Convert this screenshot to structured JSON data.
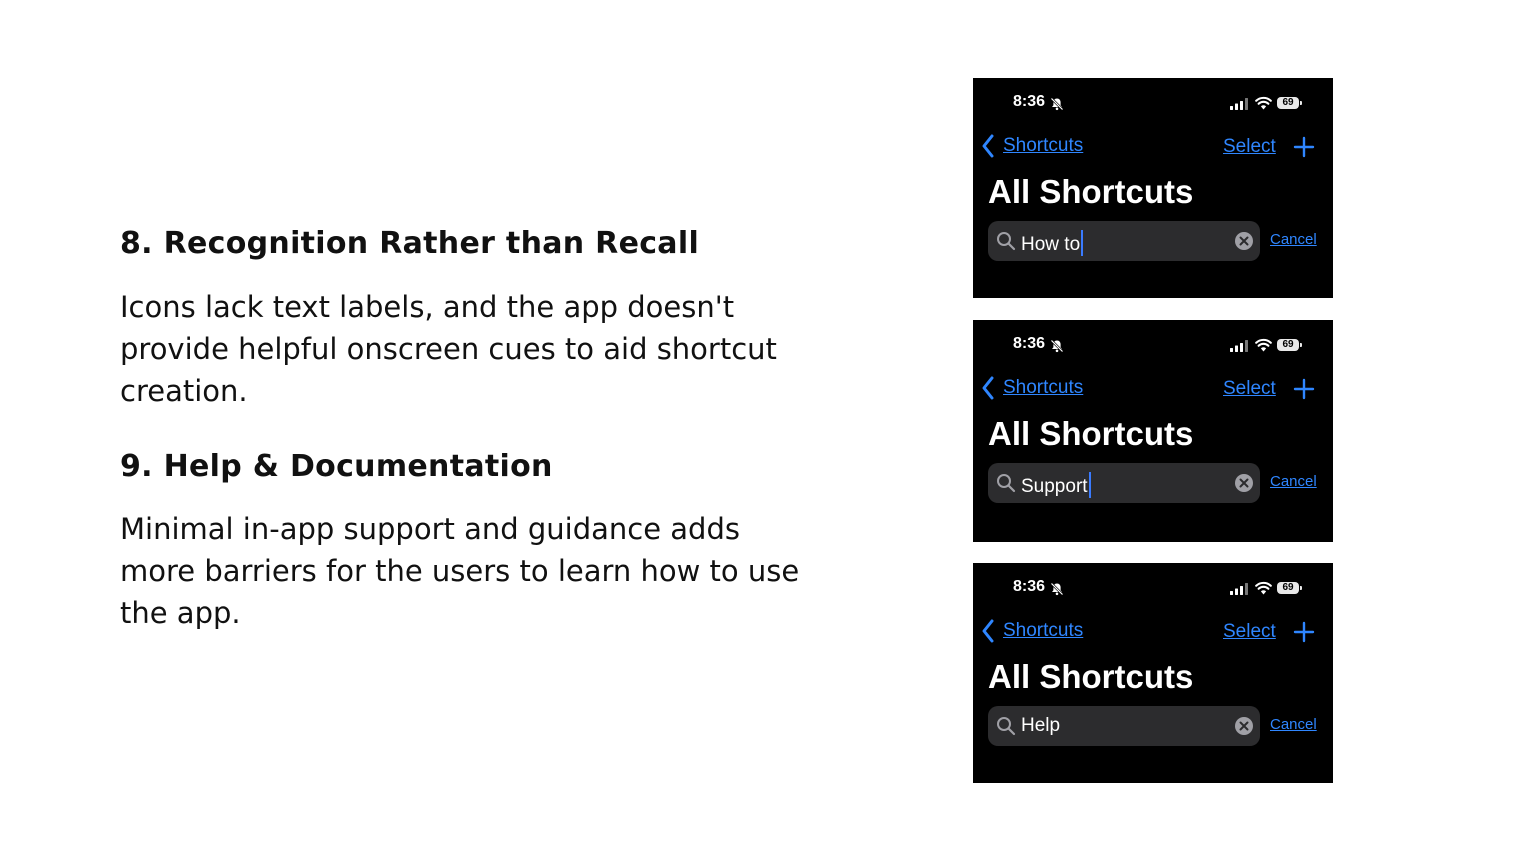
{
  "sections": [
    {
      "heading": "8. Recognition Rather than Recall",
      "body": "Icons lack text labels, and the app doesn't provide helpful onscreen cues to aid shortcut creation."
    },
    {
      "heading": "9. Help & Documentation",
      "body": "Minimal in-app support and guidance adds more barriers for the users to learn how to use the app."
    }
  ],
  "screenshots": [
    {
      "status": {
        "time": "8:36",
        "battery": "69"
      },
      "nav": {
        "back_label": "Shortcuts",
        "select_label": "Select"
      },
      "title": "All Shortcuts",
      "search": {
        "value": "How to",
        "cancel_label": "Cancel"
      }
    },
    {
      "status": {
        "time": "8:36",
        "battery": "69"
      },
      "nav": {
        "back_label": "Shortcuts",
        "select_label": "Select"
      },
      "title": "All Shortcuts",
      "search": {
        "value": "Support",
        "cancel_label": "Cancel"
      }
    },
    {
      "status": {
        "time": "8:36",
        "battery": "69"
      },
      "nav": {
        "back_label": "Shortcuts",
        "select_label": "Select"
      },
      "title": "All Shortcuts",
      "search": {
        "value": "Help",
        "cancel_label": "Cancel"
      }
    }
  ],
  "colors": {
    "accent": "#2f86ff",
    "screen_bg": "#000000",
    "search_bg": "#2c2c2e",
    "text_dark": "#111111"
  },
  "icons": [
    "bell-slash-icon",
    "signal-icon",
    "wifi-icon",
    "battery-icon",
    "chevron-left-icon",
    "plus-icon",
    "search-icon",
    "clear-icon"
  ]
}
